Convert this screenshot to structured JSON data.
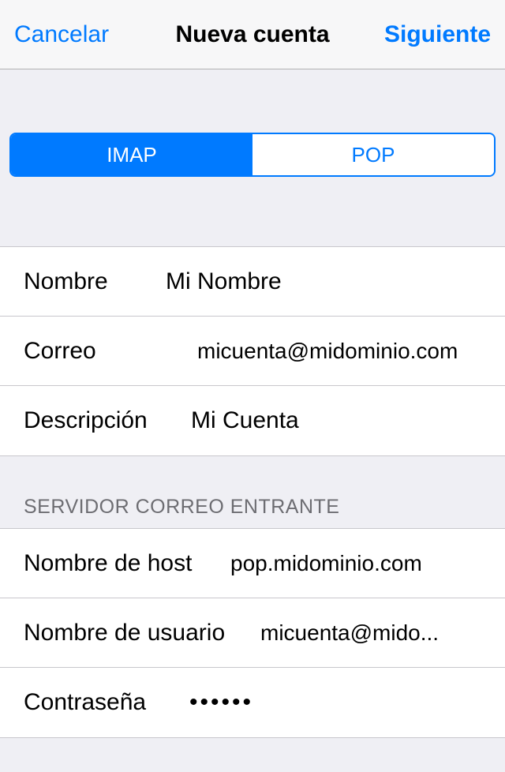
{
  "navbar": {
    "cancel": "Cancelar",
    "title": "Nueva cuenta",
    "next": "Siguiente"
  },
  "segmented": {
    "imap": "IMAP",
    "pop": "POP"
  },
  "account": {
    "name_label": "Nombre",
    "name_value": "Mi Nombre",
    "email_label": "Correo",
    "email_value": "micuenta@midominio.com",
    "description_label": "Descripción",
    "description_value": "Mi Cuenta"
  },
  "incoming": {
    "header": "SERVIDOR CORREO ENTRANTE",
    "host_label": "Nombre de host",
    "host_value": "pop.midominio.com",
    "user_label": "Nombre de usuario",
    "user_value": "micuenta@mido...",
    "password_label": "Contraseña",
    "password_value": "••••••"
  }
}
